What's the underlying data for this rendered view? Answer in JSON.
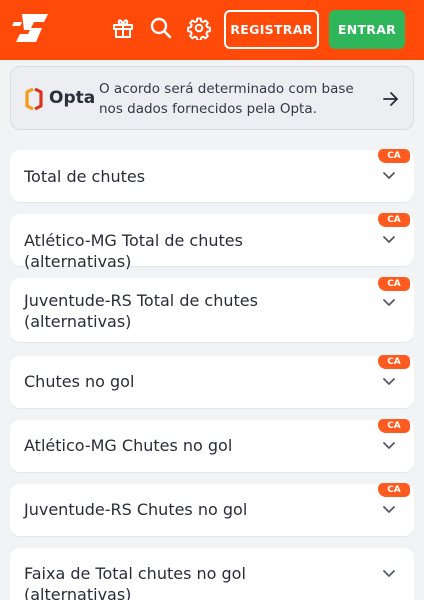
{
  "app": {
    "brand_color": "#ff4a0a",
    "icons": [
      "gift-icon",
      "search-icon",
      "gear-icon"
    ]
  },
  "header": {
    "register_label": "REGISTRAR",
    "login_label": "ENTRAR"
  },
  "opta": {
    "logo_text": "Opta",
    "message": "O acordo será determinado com base nos dados fornecidos pela Opta."
  },
  "markets": [
    {
      "label": "Total de chutes",
      "badge": "CA"
    },
    {
      "label": "Atlético-MG Total de chutes (alternativas)",
      "badge": "CA"
    },
    {
      "label": "Juventude-RS Total de chutes (alternativas)",
      "badge": "CA"
    },
    {
      "label": "Chutes no gol",
      "badge": "CA"
    },
    {
      "label": "Atlético-MG Chutes no gol",
      "badge": "CA"
    },
    {
      "label": "Juventude-RS Chutes no gol",
      "badge": "CA"
    },
    {
      "label": "Faixa de Total chutes no gol (alternativas)",
      "badge": ""
    }
  ]
}
